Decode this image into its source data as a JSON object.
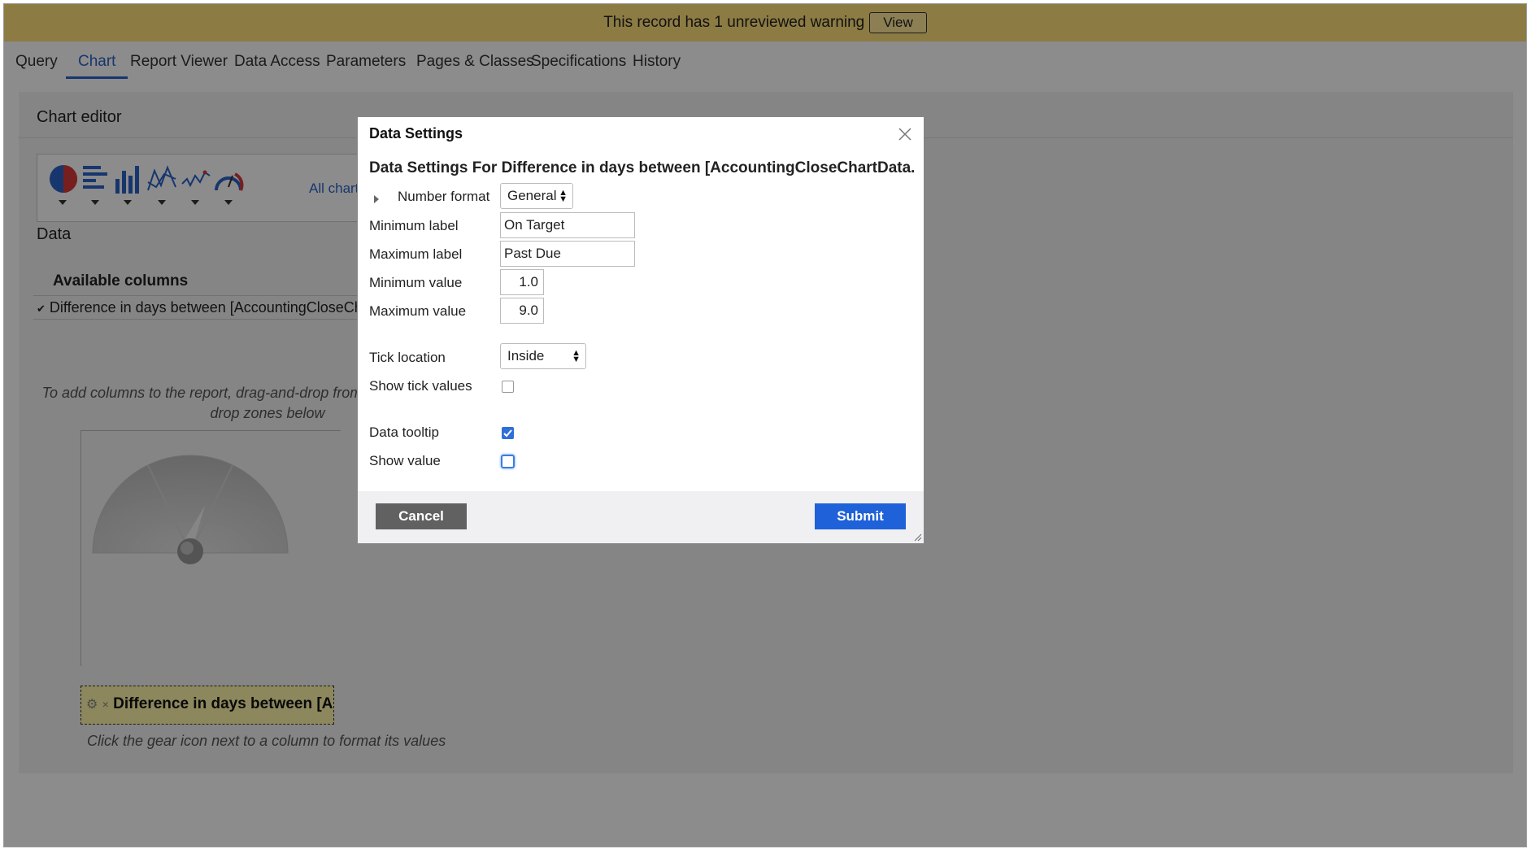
{
  "warning": {
    "text": "This record has 1 unreviewed warning",
    "view_label": "View"
  },
  "tabs": [
    {
      "label": "Query"
    },
    {
      "label": "Chart"
    },
    {
      "label": "Report Viewer"
    },
    {
      "label": "Data Access"
    },
    {
      "label": "Parameters"
    },
    {
      "label": "Pages & Classes"
    },
    {
      "label": "Specifications"
    },
    {
      "label": "History"
    }
  ],
  "active_tab": "Chart",
  "editor": {
    "title": "Chart editor",
    "all_chart_types": "All chart types",
    "data_heading": "Data",
    "available_columns_heading": "Available columns",
    "available_column": "Difference in days between [AccountingCloseChartData.TodayDate]",
    "hint": "To add columns to the report, drag-and-drop from the above list to the drop zones below",
    "dropzone_label": "Difference in days between [AccountingCloseChartData.TodayDate]",
    "gear_hint": "Click the gear icon next to a column to format its values"
  },
  "modal": {
    "title": "Data Settings",
    "subtitle": "Data Settings For Difference in days between [AccountingCloseChartData.TodayDat...",
    "number_format_label": "Number format",
    "number_format_value": "General",
    "minimum_label_label": "Minimum label",
    "minimum_label_value": "On Target",
    "maximum_label_label": "Maximum label",
    "maximum_label_value": "Past Due",
    "minimum_value_label": "Minimum value",
    "minimum_value_value": "1.0",
    "maximum_value_label": "Maximum value",
    "maximum_value_value": "9.0",
    "tick_location_label": "Tick location",
    "tick_location_value": "Inside",
    "show_tick_values_label": "Show tick values",
    "show_tick_values_checked": false,
    "data_tooltip_label": "Data tooltip",
    "data_tooltip_checked": true,
    "show_value_label": "Show value",
    "show_value_checked": false,
    "cancel_label": "Cancel",
    "submit_label": "Submit"
  },
  "colors": {
    "warning_bar": "#ffe17a",
    "accent": "#2a63c9",
    "submit": "#1f61d8",
    "cancel": "#616161"
  }
}
